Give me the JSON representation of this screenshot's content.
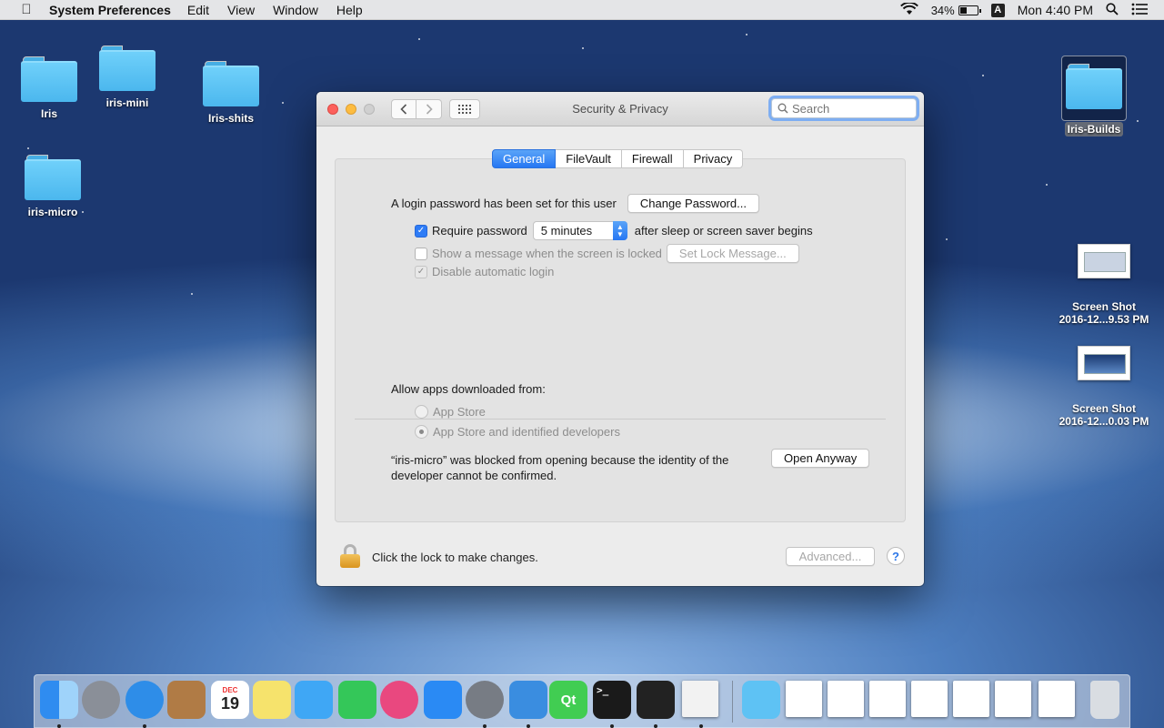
{
  "menubar": {
    "app_name": "System Preferences",
    "menus": [
      "Edit",
      "View",
      "Window",
      "Help"
    ],
    "battery": "34%",
    "input_source": "A",
    "clock": "Mon 4:40 PM"
  },
  "desktop": {
    "icons": [
      {
        "label": "Iris"
      },
      {
        "label": "iris-mini"
      },
      {
        "label": "Iris-shits"
      },
      {
        "label": "iris-micro"
      },
      {
        "label": "Iris-Builds"
      }
    ],
    "screenshots": [
      {
        "line1": "Screen Shot",
        "line2": "2016-12...9.53 PM"
      },
      {
        "line1": "Screen Shot",
        "line2": "2016-12...0.03 PM"
      }
    ]
  },
  "window": {
    "title": "Security & Privacy",
    "search_placeholder": "Search",
    "tabs": [
      {
        "label": "General",
        "active": true
      },
      {
        "label": "FileVault"
      },
      {
        "label": "Firewall"
      },
      {
        "label": "Privacy"
      }
    ],
    "general": {
      "login_text": "A login password has been set for this user",
      "change_password": "Change Password...",
      "require_password_label": "Require password",
      "require_password_value": "5 minutes",
      "after_sleep": "after sleep or screen saver begins",
      "show_message_label": "Show a message when the screen is locked",
      "set_lock_message": "Set Lock Message...",
      "disable_autologin_label": "Disable automatic login",
      "allow_apps_label": "Allow apps downloaded from:",
      "radio_app_store": "App Store",
      "radio_identified": "App Store and identified developers",
      "blocked_line1": "“iris-micro” was blocked from opening because the identity of the",
      "blocked_line2": "developer cannot be confirmed.",
      "open_anyway": "Open Anyway"
    },
    "footer": {
      "lock_text": "Click the lock to make changes.",
      "advanced": "Advanced...",
      "help": "?"
    }
  },
  "dock": {
    "items": [
      {
        "icon": "finder-icon",
        "color": "#3d8ef0"
      },
      {
        "icon": "launchpad-icon",
        "color": "#8a8f98"
      },
      {
        "icon": "safari-icon",
        "color": "#2e8de8"
      },
      {
        "icon": "contacts-icon",
        "color": "#b07b45"
      },
      {
        "icon": "calendar-icon",
        "color": "#ffffff"
      },
      {
        "icon": "notes-icon",
        "color": "#f6e36c"
      },
      {
        "icon": "messages-icon",
        "color": "#3fa7f5"
      },
      {
        "icon": "facetime-icon",
        "color": "#34c759"
      },
      {
        "icon": "itunes-icon",
        "color": "#e9487f"
      },
      {
        "icon": "app-store-icon",
        "color": "#2a8af4"
      },
      {
        "icon": "system-preferences-icon",
        "color": "#777c84"
      },
      {
        "icon": "xcode-icon",
        "color": "#3a8de0"
      },
      {
        "icon": "qt-creator-icon",
        "color": "#41cd52"
      },
      {
        "icon": "terminal-icon",
        "color": "#1a1a1a"
      },
      {
        "icon": "activity-monitor-icon",
        "color": "#222222"
      },
      {
        "icon": "textedit-icon",
        "color": "#f2f2f2"
      },
      {
        "icon": "downloads-folder-icon",
        "color": "#5ec2f4"
      },
      {
        "icon": "document-icon",
        "color": "#ffffff"
      },
      {
        "icon": "screenshot-doc-icon",
        "color": "#ffffff"
      },
      {
        "icon": "screenshot-doc-icon",
        "color": "#ffffff"
      },
      {
        "icon": "screenshot-doc-icon",
        "color": "#ffffff"
      },
      {
        "icon": "screenshot-doc-icon",
        "color": "#ffffff"
      },
      {
        "icon": "screenshot-doc-icon",
        "color": "#ffffff"
      },
      {
        "icon": "screenshot-doc-icon",
        "color": "#ffffff"
      },
      {
        "icon": "trash-icon",
        "color": "#d9dde2"
      }
    ],
    "calendar_month": "DEC",
    "calendar_day": "19",
    "qt_label": "Qt"
  }
}
